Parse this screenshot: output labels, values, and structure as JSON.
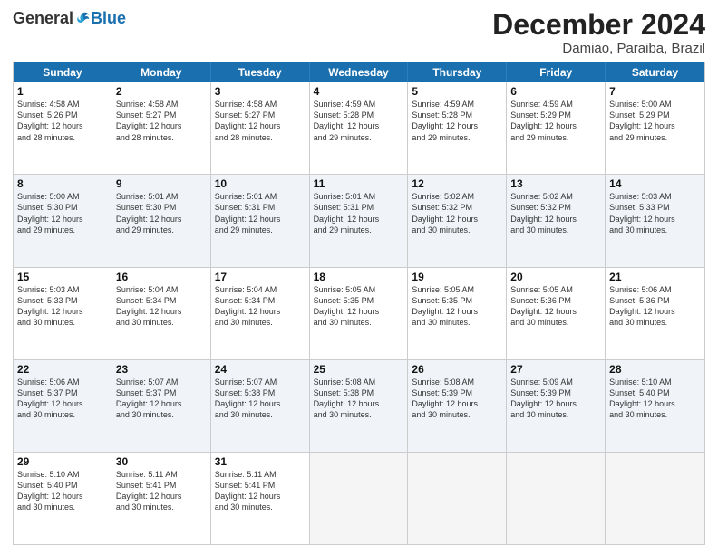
{
  "logo": {
    "general": "General",
    "blue": "Blue"
  },
  "title": "December 2024",
  "location": "Damiao, Paraiba, Brazil",
  "headers": [
    "Sunday",
    "Monday",
    "Tuesday",
    "Wednesday",
    "Thursday",
    "Friday",
    "Saturday"
  ],
  "rows": [
    [
      {
        "day": "1",
        "text": "Sunrise: 4:58 AM\nSunset: 5:26 PM\nDaylight: 12 hours\nand 28 minutes."
      },
      {
        "day": "2",
        "text": "Sunrise: 4:58 AM\nSunset: 5:27 PM\nDaylight: 12 hours\nand 28 minutes."
      },
      {
        "day": "3",
        "text": "Sunrise: 4:58 AM\nSunset: 5:27 PM\nDaylight: 12 hours\nand 28 minutes."
      },
      {
        "day": "4",
        "text": "Sunrise: 4:59 AM\nSunset: 5:28 PM\nDaylight: 12 hours\nand 29 minutes."
      },
      {
        "day": "5",
        "text": "Sunrise: 4:59 AM\nSunset: 5:28 PM\nDaylight: 12 hours\nand 29 minutes."
      },
      {
        "day": "6",
        "text": "Sunrise: 4:59 AM\nSunset: 5:29 PM\nDaylight: 12 hours\nand 29 minutes."
      },
      {
        "day": "7",
        "text": "Sunrise: 5:00 AM\nSunset: 5:29 PM\nDaylight: 12 hours\nand 29 minutes."
      }
    ],
    [
      {
        "day": "8",
        "text": "Sunrise: 5:00 AM\nSunset: 5:30 PM\nDaylight: 12 hours\nand 29 minutes."
      },
      {
        "day": "9",
        "text": "Sunrise: 5:01 AM\nSunset: 5:30 PM\nDaylight: 12 hours\nand 29 minutes."
      },
      {
        "day": "10",
        "text": "Sunrise: 5:01 AM\nSunset: 5:31 PM\nDaylight: 12 hours\nand 29 minutes."
      },
      {
        "day": "11",
        "text": "Sunrise: 5:01 AM\nSunset: 5:31 PM\nDaylight: 12 hours\nand 29 minutes."
      },
      {
        "day": "12",
        "text": "Sunrise: 5:02 AM\nSunset: 5:32 PM\nDaylight: 12 hours\nand 30 minutes."
      },
      {
        "day": "13",
        "text": "Sunrise: 5:02 AM\nSunset: 5:32 PM\nDaylight: 12 hours\nand 30 minutes."
      },
      {
        "day": "14",
        "text": "Sunrise: 5:03 AM\nSunset: 5:33 PM\nDaylight: 12 hours\nand 30 minutes."
      }
    ],
    [
      {
        "day": "15",
        "text": "Sunrise: 5:03 AM\nSunset: 5:33 PM\nDaylight: 12 hours\nand 30 minutes."
      },
      {
        "day": "16",
        "text": "Sunrise: 5:04 AM\nSunset: 5:34 PM\nDaylight: 12 hours\nand 30 minutes."
      },
      {
        "day": "17",
        "text": "Sunrise: 5:04 AM\nSunset: 5:34 PM\nDaylight: 12 hours\nand 30 minutes."
      },
      {
        "day": "18",
        "text": "Sunrise: 5:05 AM\nSunset: 5:35 PM\nDaylight: 12 hours\nand 30 minutes."
      },
      {
        "day": "19",
        "text": "Sunrise: 5:05 AM\nSunset: 5:35 PM\nDaylight: 12 hours\nand 30 minutes."
      },
      {
        "day": "20",
        "text": "Sunrise: 5:05 AM\nSunset: 5:36 PM\nDaylight: 12 hours\nand 30 minutes."
      },
      {
        "day": "21",
        "text": "Sunrise: 5:06 AM\nSunset: 5:36 PM\nDaylight: 12 hours\nand 30 minutes."
      }
    ],
    [
      {
        "day": "22",
        "text": "Sunrise: 5:06 AM\nSunset: 5:37 PM\nDaylight: 12 hours\nand 30 minutes."
      },
      {
        "day": "23",
        "text": "Sunrise: 5:07 AM\nSunset: 5:37 PM\nDaylight: 12 hours\nand 30 minutes."
      },
      {
        "day": "24",
        "text": "Sunrise: 5:07 AM\nSunset: 5:38 PM\nDaylight: 12 hours\nand 30 minutes."
      },
      {
        "day": "25",
        "text": "Sunrise: 5:08 AM\nSunset: 5:38 PM\nDaylight: 12 hours\nand 30 minutes."
      },
      {
        "day": "26",
        "text": "Sunrise: 5:08 AM\nSunset: 5:39 PM\nDaylight: 12 hours\nand 30 minutes."
      },
      {
        "day": "27",
        "text": "Sunrise: 5:09 AM\nSunset: 5:39 PM\nDaylight: 12 hours\nand 30 minutes."
      },
      {
        "day": "28",
        "text": "Sunrise: 5:10 AM\nSunset: 5:40 PM\nDaylight: 12 hours\nand 30 minutes."
      }
    ],
    [
      {
        "day": "29",
        "text": "Sunrise: 5:10 AM\nSunset: 5:40 PM\nDaylight: 12 hours\nand 30 minutes."
      },
      {
        "day": "30",
        "text": "Sunrise: 5:11 AM\nSunset: 5:41 PM\nDaylight: 12 hours\nand 30 minutes."
      },
      {
        "day": "31",
        "text": "Sunrise: 5:11 AM\nSunset: 5:41 PM\nDaylight: 12 hours\nand 30 minutes."
      },
      {
        "day": "",
        "text": ""
      },
      {
        "day": "",
        "text": ""
      },
      {
        "day": "",
        "text": ""
      },
      {
        "day": "",
        "text": ""
      }
    ]
  ]
}
